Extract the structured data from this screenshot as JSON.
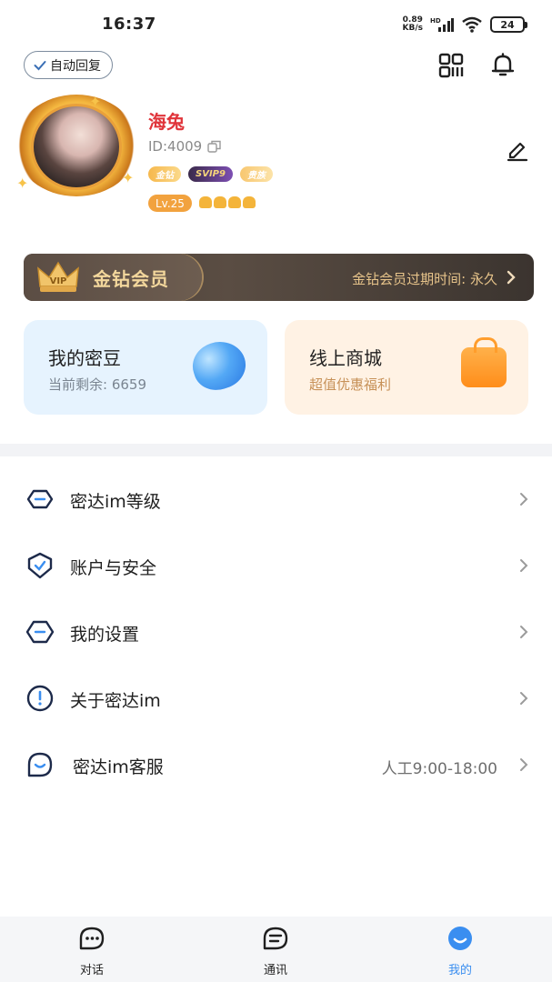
{
  "status_bar": {
    "time": "16:37",
    "net_speed_value": "0.89",
    "net_speed_unit": "KB/s",
    "network_type": "HD",
    "battery": "24"
  },
  "header": {
    "auto_reply_label": "自动回复"
  },
  "profile": {
    "nickname": "海兔",
    "user_id": "ID:4009",
    "badges": [
      "金钻",
      "SVIP9",
      "贵族"
    ],
    "level": "Lv.25"
  },
  "vip_banner": {
    "crown_text": "VIP",
    "title": "金钻会员",
    "expire_text": "金钻会员过期时间: 永久"
  },
  "cards": {
    "beans": {
      "title": "我的密豆",
      "subtitle": "当前剩余: 6659"
    },
    "shop": {
      "title": "线上商城",
      "subtitle": "超值优惠福利"
    }
  },
  "menu": {
    "items": [
      {
        "label": "密达im等级",
        "icon": "diamond-badge-icon"
      },
      {
        "label": "账户与安全",
        "icon": "shield-check-icon"
      },
      {
        "label": "我的设置",
        "icon": "hexagon-settings-icon"
      },
      {
        "label": "关于密达im",
        "icon": "info-circle-icon"
      },
      {
        "label": "密达im客服",
        "icon": "service-smile-icon",
        "value": "人工9:00-18:00"
      }
    ]
  },
  "bottom_nav": {
    "items": [
      {
        "label": "对话",
        "icon": "chat-bubble-icon"
      },
      {
        "label": "通讯",
        "icon": "contacts-icon"
      },
      {
        "label": "我的",
        "icon": "profile-smile-icon",
        "active": true
      }
    ]
  },
  "colors": {
    "accent_blue": "#3a8ef0",
    "nickname_red": "#e0343a",
    "vip_gold": "#f3d79c",
    "icon_navy": "#1d2a4a"
  }
}
